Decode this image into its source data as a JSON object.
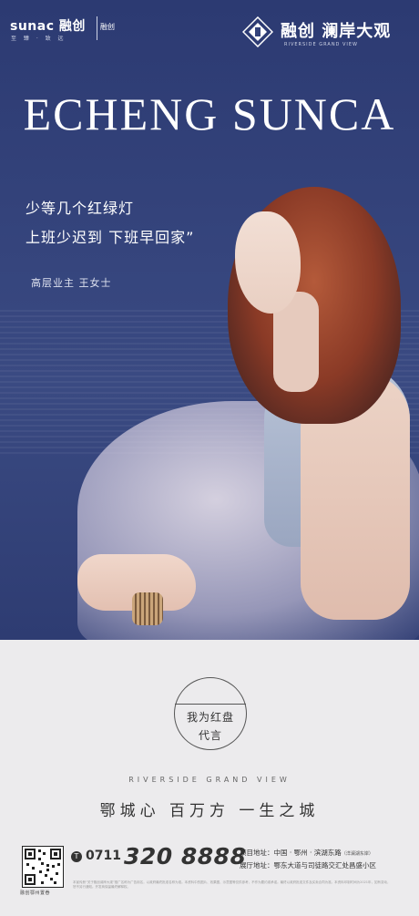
{
  "header": {
    "left_logo": "sunac 融创",
    "left_logo_sub": "至 臻 · 致 远",
    "left_mark": "融创",
    "right_logo": "融创 澜岸大观",
    "right_logo_sub": "RIVERSIDE GRAND VIEW"
  },
  "hero": {
    "headline": "ECHENG SUNCA",
    "quote_line1": "少等几个红绿灯",
    "quote_line2": "上班少迟到  下班早回家”",
    "attribution": "高层业主  王女士"
  },
  "seal": {
    "line1": "我为红盘",
    "line2": "代言"
  },
  "tagline": {
    "english": "RIVERSIDE GRAND VIEW",
    "chinese": "鄂城心  百万方  一生之城"
  },
  "footer": {
    "qr_label": "融创鄂州置眷",
    "phone_icon": "T",
    "area_code": "0711",
    "phone_number": "320 8888",
    "project_address": "项目地址：中国 · 鄂州 · 滨湖东路",
    "project_address_note": "（洋澜湖东岸）",
    "gallery_address": "展厅地址：鄂东大道与司徒路交汇处昌盛小区",
    "disclaimer": "本宣传册“关于融创澜岸大观”推广名称为广告用名，以政府最终批准名称为准。本资料中的图片、效果图、示意图等仅供参考，不作为要约或承诺。最终以政府批准文件及买卖合同为准。本资料印制时间为2021年，如有变动，恕不另行通知。开发商保留最终解释权。"
  },
  "colors": {
    "hero_background": "#33427a",
    "page_background": "#ecebed",
    "text_dark": "#333333"
  },
  "icons": {
    "right_logo_icon": "diamond-emblem-icon",
    "phone": "phone-icon",
    "qr": "qr-code-icon"
  }
}
